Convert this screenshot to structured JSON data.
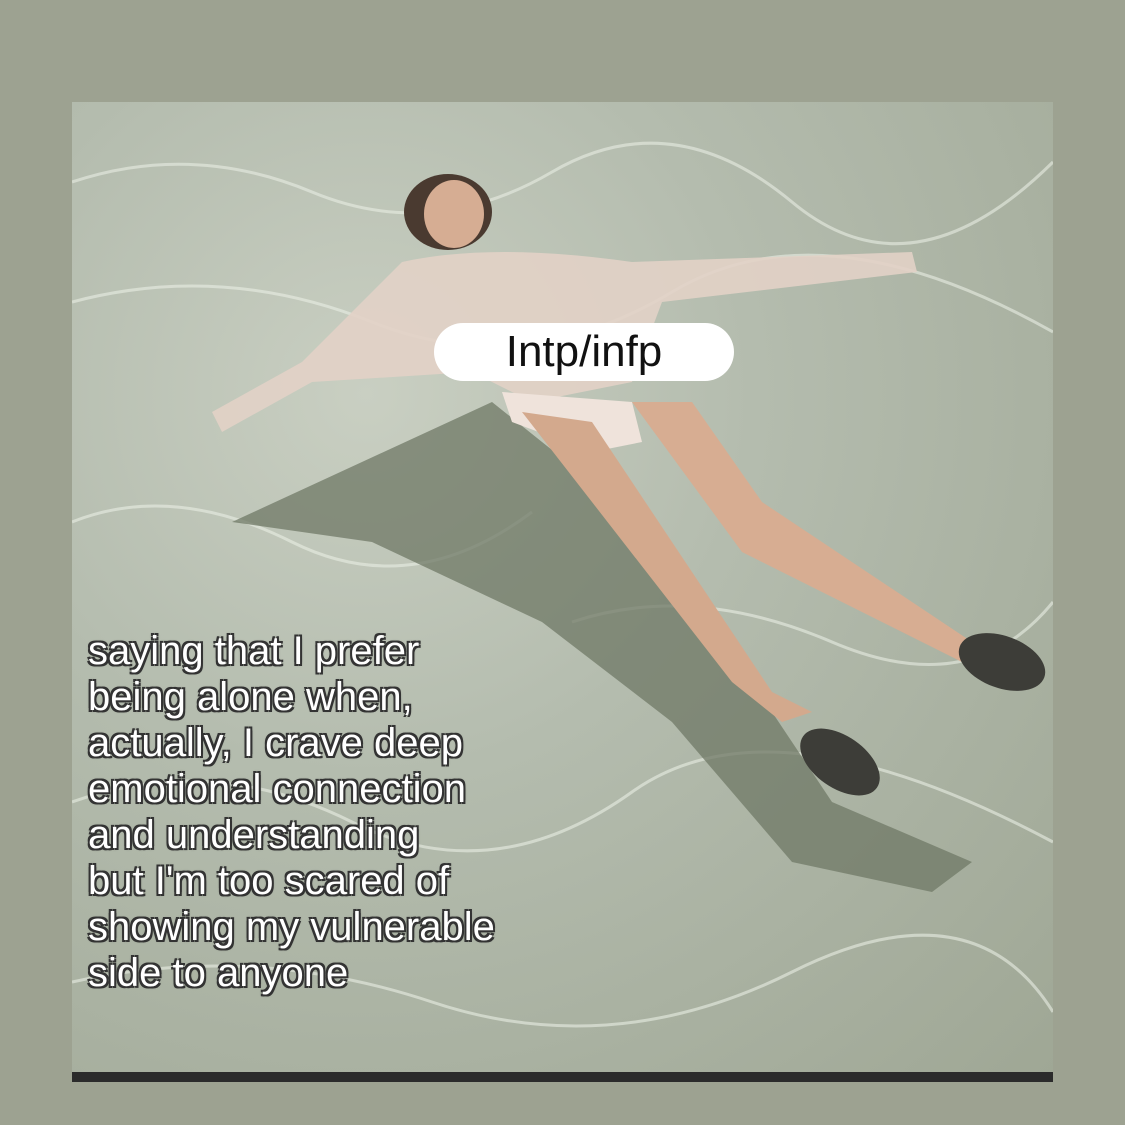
{
  "label": "Intp/infp",
  "caption": {
    "lines": [
      "saying that I prefer",
      "being alone when,",
      "actually, I crave deep",
      "emotional connection",
      "and understanding",
      "but I'm too scared of",
      "showing my vulnerable",
      "side to anyone"
    ]
  },
  "colors": {
    "background": "#9da291",
    "water": "#b4bcae",
    "label_bg": "#ffffff"
  }
}
